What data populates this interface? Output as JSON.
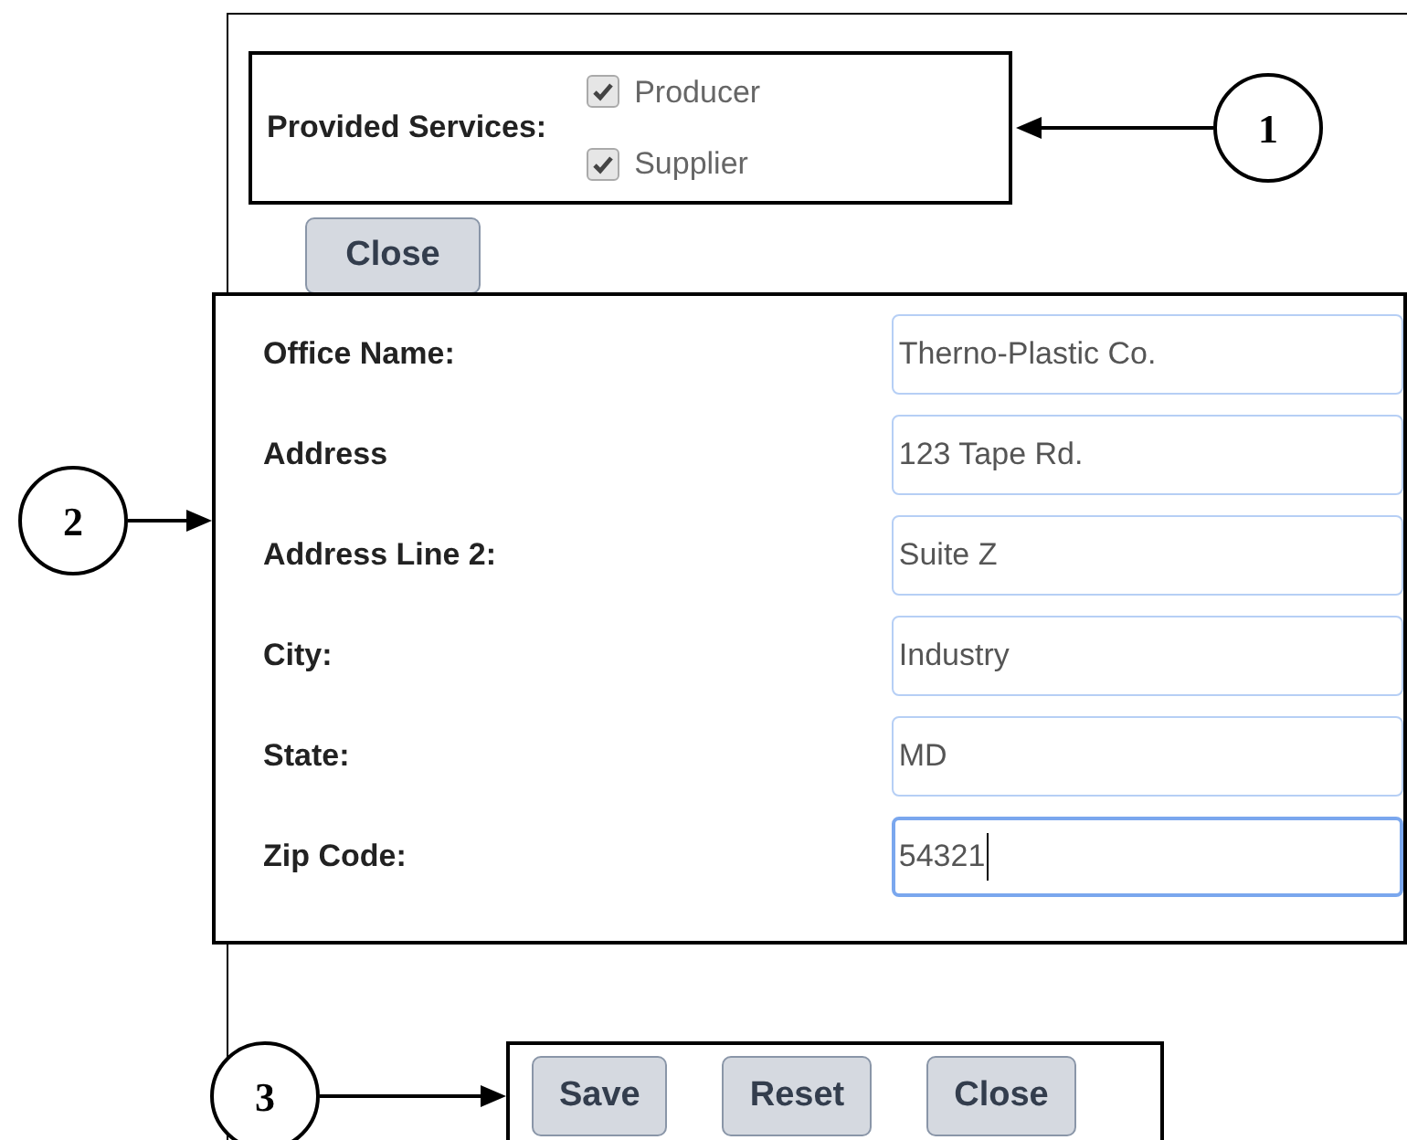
{
  "services": {
    "label": "Provided Services:",
    "options": [
      {
        "label": "Producer",
        "checked": true
      },
      {
        "label": "Supplier",
        "checked": true
      }
    ]
  },
  "top_button": "Close",
  "fields": [
    {
      "label": "Office Name:",
      "value": "Therno-Plastic Co.",
      "focused": false
    },
    {
      "label": "Address",
      "value": "123 Tape Rd.",
      "focused": false
    },
    {
      "label": "Address Line 2:",
      "value": "Suite Z",
      "focused": false
    },
    {
      "label": "City:",
      "value": "Industry",
      "focused": false
    },
    {
      "label": "State:",
      "value": "MD",
      "focused": false
    },
    {
      "label": "Zip Code:",
      "value": "54321",
      "focused": true
    }
  ],
  "buttons": [
    "Save",
    "Reset",
    "Close"
  ],
  "callouts": [
    {
      "number": "1"
    },
    {
      "number": "2"
    },
    {
      "number": "3"
    }
  ]
}
